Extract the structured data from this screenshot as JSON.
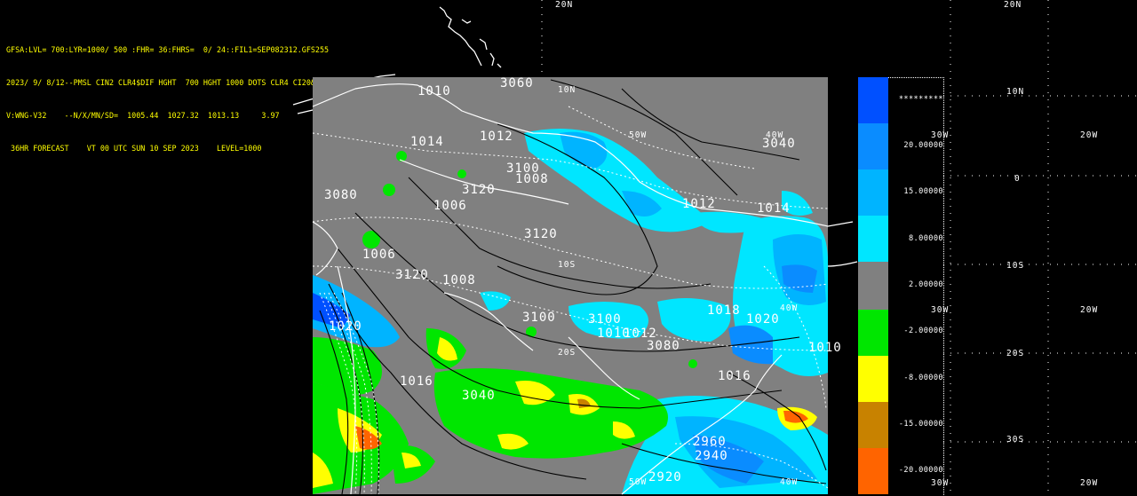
{
  "header": {
    "lines": [
      "GFSA:LVL= 700:LYR=1000/ 500 :FHR= 36:FHRS=  0/ 24::FIL1=SEP082312.GFS255",
      "2023/ 9/ 8/12--PMSL CIN2 CLR4$DIF HGHT  700 HGHT 1000 DOTS CLR4 CI20&",
      "V:WNG-V32    --N/X/MN/SD=  1005.44  1027.32  1013.13     3.97",
      " 36HR FORECAST    VT 00 UTC SUN 10 SEP 2023    LEVEL=1000"
    ]
  },
  "colors": {
    "background": "#000000",
    "map_gray": "#808080",
    "header_text": "#ffff00"
  },
  "colorbar": {
    "segments": [
      {
        "color": "#0050ff"
      },
      {
        "color": "#0a8cff"
      },
      {
        "color": "#00b4ff"
      },
      {
        "color": "#00e6ff"
      },
      {
        "color": "#808080"
      },
      {
        "color": "#00e600"
      },
      {
        "color": "#ffff00"
      },
      {
        "color": "#c88200"
      },
      {
        "color": "#ff6400"
      }
    ],
    "labels": [
      "*********",
      "20.00000",
      "15.00000",
      "8.00000",
      "2.00000",
      "-2.00000",
      "-8.00000",
      "-15.00000",
      "-20.00000"
    ]
  },
  "lat_lon_labels": {
    "top_20n_a": "20N",
    "top_20n_b": "20N",
    "r_10n": "10N",
    "r_30w_a": "30W",
    "r_20w_a": "20W",
    "r_0": "0",
    "r_10s": "10S",
    "r_30w_b": "30W",
    "r_20w_b": "20W",
    "r_20s": "20S",
    "r_30s": "30S",
    "r_30w_c": "30W",
    "r_20w_c": "20W",
    "m_10n": "10N",
    "m_50w": "50W",
    "m_40w_a": "40W",
    "m_10s": "10S",
    "m_40w_b": "40W",
    "m_20s": "20S",
    "m_50w_b": "50W",
    "m_40w_c": "40W"
  },
  "contour_labels": [
    "3060",
    "3040",
    "3120",
    "3100",
    "3120",
    "3120",
    "3100",
    "3100",
    "3080",
    "3040",
    "2960",
    "2940",
    "2920",
    "3080",
    "1010",
    "1012",
    "1008",
    "1006",
    "1006",
    "1008",
    "1012",
    "1014",
    "1010",
    "1012",
    "1016",
    "1020",
    "1018",
    "1014",
    "1016",
    "1020",
    "1010"
  ]
}
